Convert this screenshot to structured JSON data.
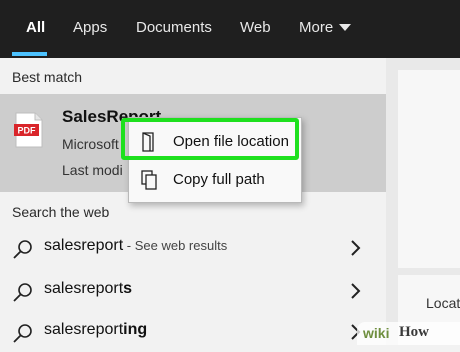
{
  "tabs": [
    {
      "label": "All"
    },
    {
      "label": "Apps"
    },
    {
      "label": "Documents"
    },
    {
      "label": "Web"
    },
    {
      "label": "More"
    }
  ],
  "active_tab": "All",
  "best_match": {
    "heading": "Best match",
    "title": "SalesReport",
    "subtitle": "Microsoft",
    "subtitle2": "Last modi",
    "icon_text": "PDF"
  },
  "search_web": {
    "heading": "Search the web",
    "rows": [
      {
        "query": "salesreport",
        "suffix": " - See web results"
      },
      {
        "query_prefix": "salesreport",
        "query_bold": "s"
      },
      {
        "query_prefix": "salesreport",
        "query_bold": "ing"
      }
    ]
  },
  "context_menu": {
    "items": [
      {
        "label": "Open file location"
      },
      {
        "label": "Copy full path"
      }
    ]
  },
  "right_panel": {
    "text": "Locat"
  },
  "watermark": {
    "wiki": "wiki",
    "how": "How"
  },
  "colors": {
    "topbar": "#1f1f1f",
    "accent": "#4cc2ff",
    "highlight": "#1ee01e",
    "pdf_red": "#d9252a"
  }
}
